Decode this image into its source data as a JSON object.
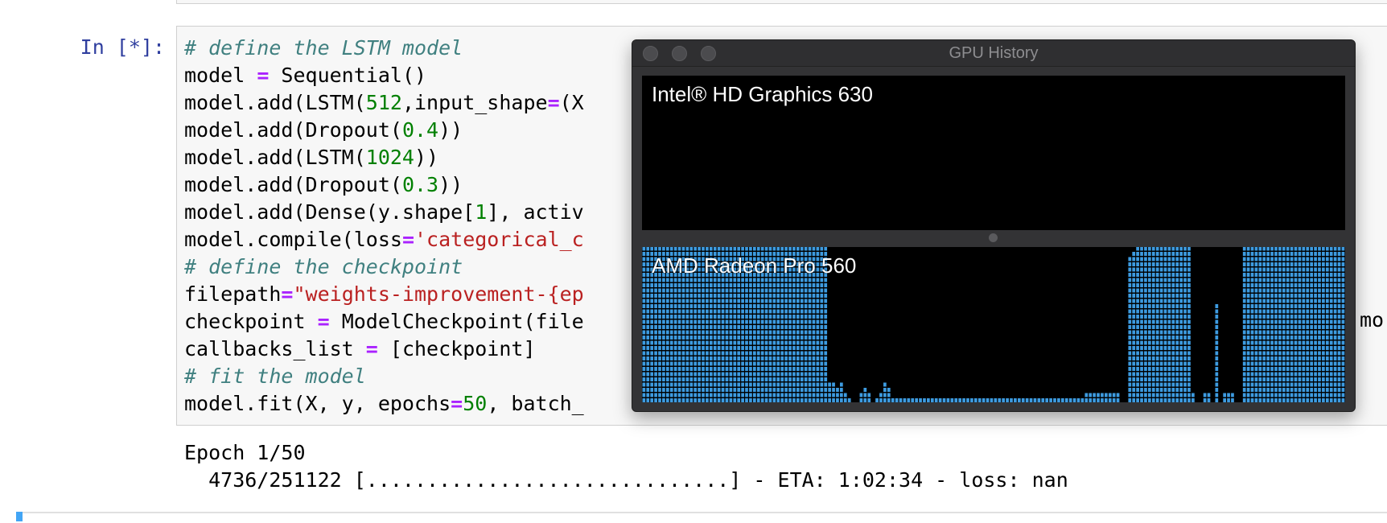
{
  "notebook": {
    "prompt": "In [*]:",
    "code_tail_right": "mo",
    "output_lines": [
      "Epoch 1/50",
      "  4736/251122 [..............................] - ETA: 1:02:34 - loss: nan"
    ]
  },
  "gpu_window": {
    "title": "GPU History",
    "gpu1_name": "Intel® HD Graphics 630",
    "gpu2_name": "AMD Radeon Pro 560",
    "bar_color": "#3d9be0",
    "gpu2_usage_levels": [
      100,
      100,
      100,
      100,
      100,
      100,
      100,
      100,
      100,
      100,
      100,
      100,
      100,
      100,
      100,
      100,
      100,
      100,
      100,
      100,
      100,
      100,
      100,
      100,
      100,
      100,
      100,
      100,
      100,
      100,
      100,
      100,
      100,
      100,
      100,
      100,
      100,
      100,
      100,
      100,
      100,
      100,
      100,
      100,
      100,
      100,
      100,
      12,
      12,
      8,
      12,
      4,
      2,
      0,
      0,
      6,
      8,
      6,
      0,
      2,
      4,
      12,
      8,
      2,
      2,
      2,
      2,
      2,
      2,
      2,
      2,
      2,
      2,
      2,
      2,
      2,
      2,
      2,
      2,
      2,
      2,
      2,
      2,
      2,
      2,
      2,
      2,
      2,
      2,
      2,
      2,
      2,
      2,
      2,
      2,
      2,
      2,
      2,
      2,
      2,
      2,
      2,
      2,
      2,
      2,
      2,
      2,
      2,
      2,
      2,
      2,
      2,
      4,
      4,
      4,
      4,
      4,
      4,
      4,
      4,
      6,
      0,
      0,
      92,
      96,
      100,
      100,
      100,
      100,
      100,
      100,
      100,
      100,
      100,
      100,
      100,
      100,
      100,
      100,
      4,
      0,
      0,
      4,
      4,
      0,
      62,
      0,
      4,
      4,
      4,
      0,
      0,
      100,
      100,
      100,
      100,
      100,
      100,
      100,
      100,
      100,
      100,
      100,
      100,
      100,
      100,
      100,
      100,
      100,
      100,
      100,
      100,
      100,
      100,
      100,
      100,
      100,
      100
    ]
  }
}
